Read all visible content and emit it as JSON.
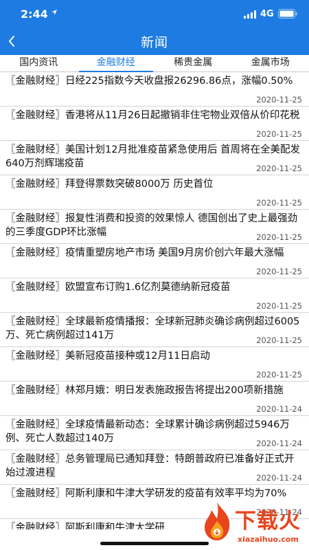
{
  "status_bar": {
    "time": "2:44",
    "network": "4G"
  },
  "header": {
    "title": "新闻",
    "back_icon": "chevron-left-icon"
  },
  "colors": {
    "accent": "#1d7be2",
    "watermark": "#e8451c"
  },
  "tabs": [
    {
      "label": "国内资讯",
      "active": false
    },
    {
      "label": "金融财经",
      "active": true
    },
    {
      "label": "稀贵金属",
      "active": false
    },
    {
      "label": "金属市场",
      "active": false
    }
  ],
  "news": [
    {
      "title": "〖金融财经〗日经225指数今天收盘报26296.86点，涨幅0.50%",
      "date": "2020-11-25"
    },
    {
      "title": "〖金融财经〗香港将从11月26日起撤销非住宅物业双倍从价印花税",
      "date": "2020-11-25"
    },
    {
      "title": "〖金融财经〗美国计划12月批准疫苗紧急使用后 首周将在全美配发640万剂辉瑞疫苗",
      "date": "2020-11-25"
    },
    {
      "title": "〖金融财经〗拜登得票数突破8000万 历史首位",
      "date": "2020-11-25"
    },
    {
      "title": "〖金融财经〗报复性消费和投资的效果惊人 德国创出了史上最强劲的三季度GDP环比涨幅",
      "date": "2020-11-25"
    },
    {
      "title": "〖金融财经〗疫情重塑房地产市场 美国9月房价创六年最大涨幅",
      "date": "2020-11-25"
    },
    {
      "title": "〖金融财经〗欧盟宣布订购1.6亿剂莫德纳新冠疫苗",
      "date": "2020-11-25"
    },
    {
      "title": "〖金融财经〗全球最新疫情播报：全球新冠肺炎确诊病例超过6005万、死亡病例超过141万",
      "date": "2020-11-25"
    },
    {
      "title": "〖金融财经〗美新冠疫苗接种或12月11日启动",
      "date": "2020-11-25"
    },
    {
      "title": "〖金融财经〗林郑月娥：明日发表施政报告将提出200项新措施",
      "date": "2020-11-24"
    },
    {
      "title": "〖金融财经〗全球疫情最新动态：全球累计确诊病例超过5946万例、死亡人数超过140万",
      "date": "2020-11-24"
    },
    {
      "title": "〖金融财经〗总务管理局已通知拜登：特朗普政府已准备好正式开始过渡进程",
      "date": "2020-11-24"
    },
    {
      "title": "〖金融财经〗阿斯利康和牛津大学研发的疫苗有效率平均为70%",
      "date": "2020-11-24"
    },
    {
      "title": "〖金融财经〗阿斯利康和牛津大学研",
      "date": ""
    }
  ],
  "watermark": {
    "brand": "下载火",
    "url": "xiazaihuo.com"
  }
}
